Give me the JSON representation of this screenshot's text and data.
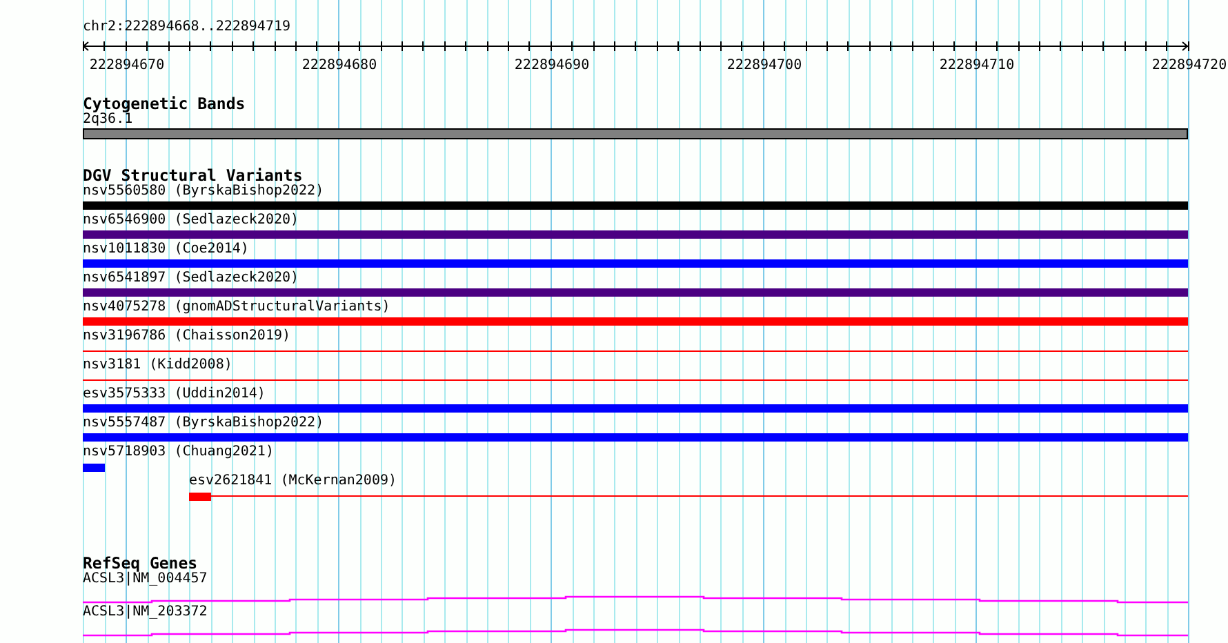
{
  "location": "chr2:222894668..222894719",
  "ruler": {
    "labels": [
      "222894670",
      "222894680",
      "222894690",
      "222894700",
      "222894710",
      "222894720"
    ]
  },
  "tracks": [
    {
      "title": "Cytogenetic Bands",
      "features": [
        {
          "label": "2q36.1",
          "kind": "band",
          "color": "#808080"
        }
      ]
    },
    {
      "title": "DGV Structural Variants",
      "features": [
        {
          "label": "nsv5560580 (ByrskaBishop2022)",
          "kind": "thick",
          "color": "#000000"
        },
        {
          "label": "nsv6546900 (Sedlazeck2020)",
          "kind": "thick",
          "color": "#4b0082"
        },
        {
          "label": "nsv1011830 (Coe2014)",
          "kind": "thick",
          "color": "#0000ff"
        },
        {
          "label": "nsv6541897 (Sedlazeck2020)",
          "kind": "thick",
          "color": "#4b0082"
        },
        {
          "label": "nsv4075278 (gnomADStructuralVariants)",
          "kind": "thick",
          "color": "#ff0000"
        },
        {
          "label": "nsv3196786 (Chaisson2019)",
          "kind": "thin",
          "color": "#ff0000"
        },
        {
          "label": "nsv3181 (Kidd2008)",
          "kind": "thin",
          "color": "#ff0000"
        },
        {
          "label": "esv3575333 (Uddin2014)",
          "kind": "thick",
          "color": "#0000ff"
        },
        {
          "label": "nsv5557487 (ByrskaBishop2022)",
          "kind": "thick",
          "color": "#0000ff"
        },
        {
          "label": "nsv5718903 (Chuang2021)",
          "kind": "stub",
          "color": "#0000ff"
        },
        {
          "label": "esv2621841 (McKernan2009)",
          "kind": "offset-stub",
          "color": "#ff0000"
        }
      ]
    },
    {
      "title": "RefSeq Genes",
      "features": [
        {
          "label": "ACSL3|NM_004457",
          "kind": "gene",
          "color": "#ff00ff"
        },
        {
          "label": "ACSL3|NM_203372",
          "kind": "gene",
          "color": "#ff00ff"
        }
      ]
    }
  ]
}
